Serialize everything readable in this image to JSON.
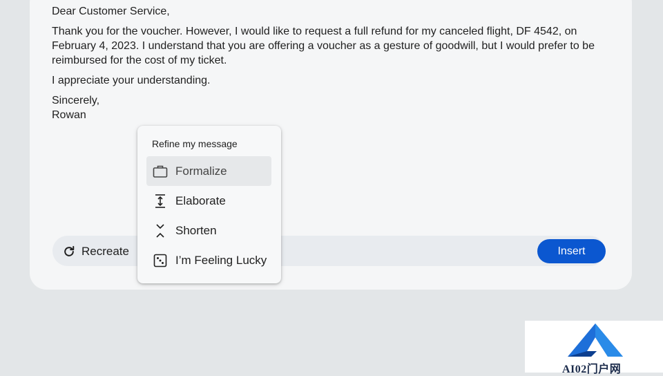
{
  "message": {
    "greeting": "Dear Customer Service,",
    "body": "Thank you for the voucher. However, I would like to request a full refund for my canceled flight, DF 4542, on February 4, 2023. I understand that you are offering a voucher as a gesture of goodwill, but I would prefer to be reimbursed for the cost of my ticket.",
    "closing_line": "I appreciate your understanding.",
    "signoff": "Sincerely,",
    "name": "Rowan"
  },
  "toolbar": {
    "recreate_label": "Recreate",
    "insert_label": "Insert"
  },
  "menu": {
    "title": "Refine my message",
    "items": [
      {
        "label": "Formalize",
        "icon": "briefcase-icon",
        "active": true
      },
      {
        "label": "Elaborate",
        "icon": "expand-vertical-icon",
        "active": false
      },
      {
        "label": "Shorten",
        "icon": "collapse-vertical-icon",
        "active": false
      },
      {
        "label": "I’m Feeling Lucky",
        "icon": "dice-icon",
        "active": false
      }
    ]
  },
  "watermark": {
    "text": "AI02门户网"
  },
  "colors": {
    "accent": "#0b57d0",
    "background": "#e3e6e8",
    "card": "#f5f6f7"
  }
}
